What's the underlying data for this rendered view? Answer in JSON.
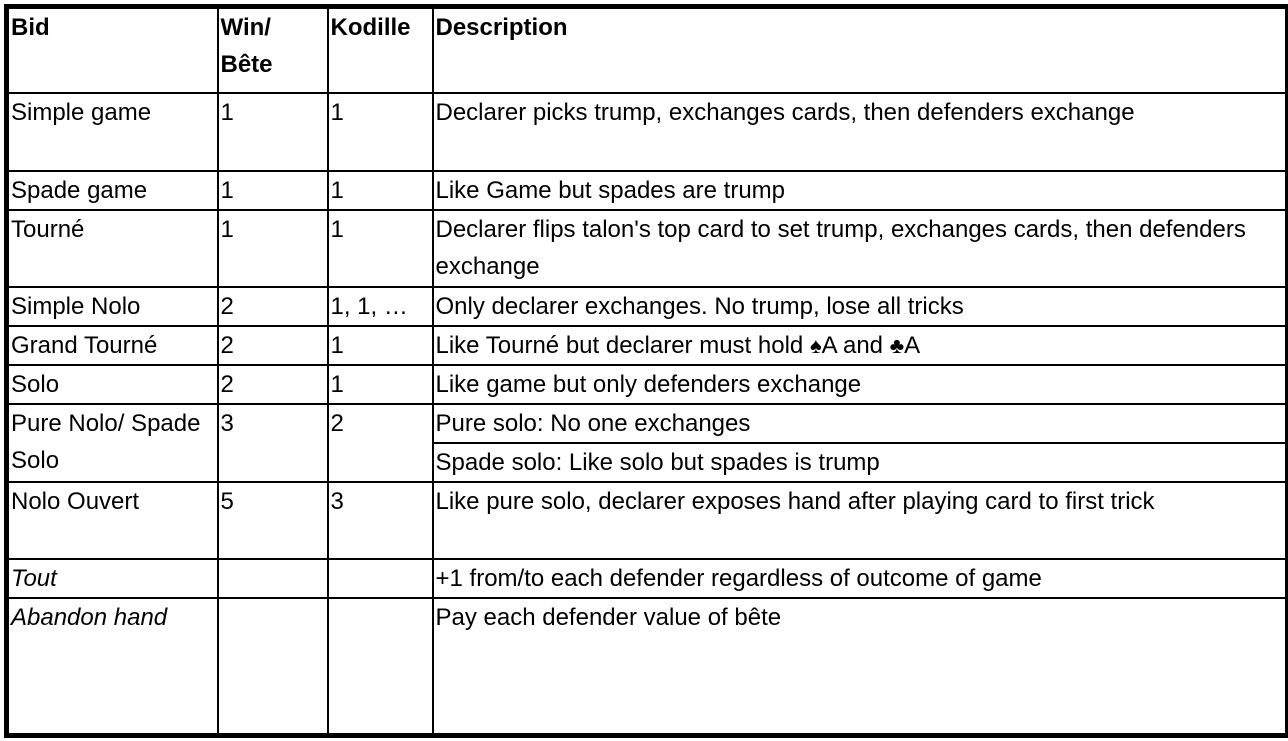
{
  "headers": {
    "bid": "Bid",
    "win_bete_line1": "Win/",
    "win_bete_line2": "Bête",
    "kodille": "Kodille",
    "description": "Description"
  },
  "rows": [
    {
      "bid": "Simple game",
      "win": "1",
      "kodille": "1",
      "description": "Declarer picks trump, exchanges cards, then defenders exchange"
    },
    {
      "bid": "Spade game",
      "win": "1",
      "kodille": "1",
      "description": "Like Game but spades are trump"
    },
    {
      "bid": "Tourné",
      "win": "1",
      "kodille": "1",
      "description": "Declarer flips talon's top card to set trump, exchanges cards, then defenders exchange"
    },
    {
      "bid": "Simple Nolo",
      "win": "2",
      "kodille": "1, 1, …",
      "description": "Only declarer exchanges. No trump, lose all tricks"
    },
    {
      "bid": "Grand Tourné",
      "win": "2",
      "kodille": "1",
      "description_parts": [
        "Like Tourné but declarer must hold ",
        "♠",
        "A and ",
        "♣",
        "A"
      ]
    },
    {
      "bid": "Solo",
      "win": "2",
      "kodille": "1",
      "description": "Like game but only defenders exchange"
    },
    {
      "bid": "Pure Nolo/ Spade Solo",
      "win": "3",
      "kodille": "2",
      "description": "Pure solo: No one exchanges",
      "description_b": "Spade solo: Like solo but spades is trump"
    },
    {
      "bid": "Nolo Ouvert",
      "win": "5",
      "kodille": "3",
      "description": "Like pure solo, declarer exposes hand after playing card to first trick"
    },
    {
      "bid": "Tout",
      "win": "",
      "kodille": "",
      "description": "+1 from/to each defender regardless of outcome of game"
    },
    {
      "bid": "Abandon hand",
      "win": "",
      "kodille": "",
      "description": "Pay each defender value of bête"
    }
  ]
}
